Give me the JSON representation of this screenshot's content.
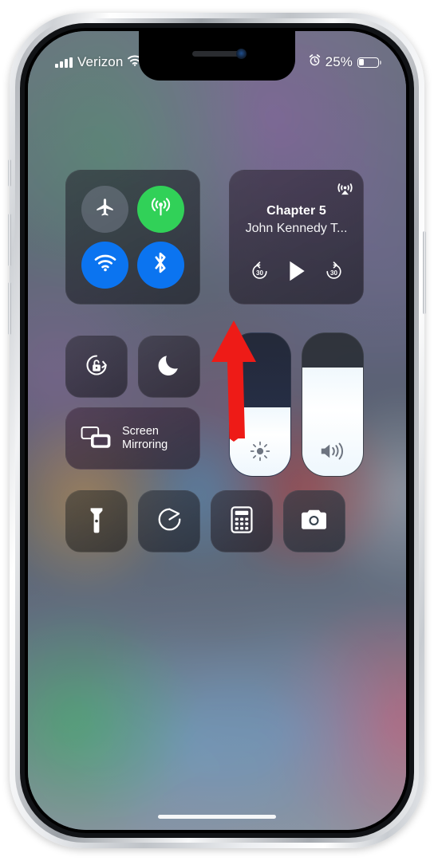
{
  "device": {
    "model": "iphone-x",
    "frame_color": "silver"
  },
  "status_bar": {
    "signal_icon": "cellular-bars-icon",
    "carrier": "Verizon",
    "wifi_icon": "wifi-icon",
    "alarm_icon": "alarm-clock-icon",
    "battery_percent": "25%",
    "battery_level": 25,
    "battery_icon": "battery-icon"
  },
  "control_center": {
    "connectivity": {
      "airplane": {
        "label": "Airplane Mode",
        "icon": "airplane-icon",
        "state": "off",
        "color": "#7c8492"
      },
      "cellular": {
        "label": "Cellular Data",
        "icon": "cellular-antenna-icon",
        "state": "on",
        "color": "#31d158"
      },
      "wifi": {
        "label": "Wi-Fi",
        "icon": "wifi-icon",
        "state": "on",
        "color": "#0b74f0"
      },
      "bluetooth": {
        "label": "Bluetooth",
        "icon": "bluetooth-icon",
        "state": "on",
        "color": "#0b74f0"
      }
    },
    "media": {
      "title": "Chapter 5",
      "artist": "John Kennedy T...",
      "airplay_icon": "airplay-audio-icon",
      "rewind_label": "30",
      "play_icon": "play-icon",
      "forward_label": "30",
      "playback_state": "paused"
    },
    "rotation_lock": {
      "label": "Rotation Lock",
      "icon": "rotation-lock-icon",
      "state": "off"
    },
    "do_not_disturb": {
      "label": "Do Not Disturb",
      "icon": "moon-icon",
      "state": "off"
    },
    "screen_mirroring": {
      "label_line1": "Screen",
      "label_line2": "Mirroring",
      "icon": "screen-mirroring-icon"
    },
    "brightness": {
      "label": "Brightness",
      "icon": "brightness-sun-icon",
      "value": 48
    },
    "volume": {
      "label": "Volume",
      "icon": "speaker-waves-icon",
      "value": 76
    },
    "quick_tiles": [
      {
        "label": "Flashlight",
        "icon": "flashlight-icon"
      },
      {
        "label": "Timer",
        "icon": "timer-icon"
      },
      {
        "label": "Calculator",
        "icon": "calculator-icon"
      },
      {
        "label": "Camera",
        "icon": "camera-icon"
      }
    ]
  },
  "annotation": {
    "arrow_icon": "red-arrow-up-icon",
    "color": "#ee1b17",
    "points_at": "brightness-slider"
  },
  "home_indicator": {
    "icon": "home-indicator-bar"
  }
}
